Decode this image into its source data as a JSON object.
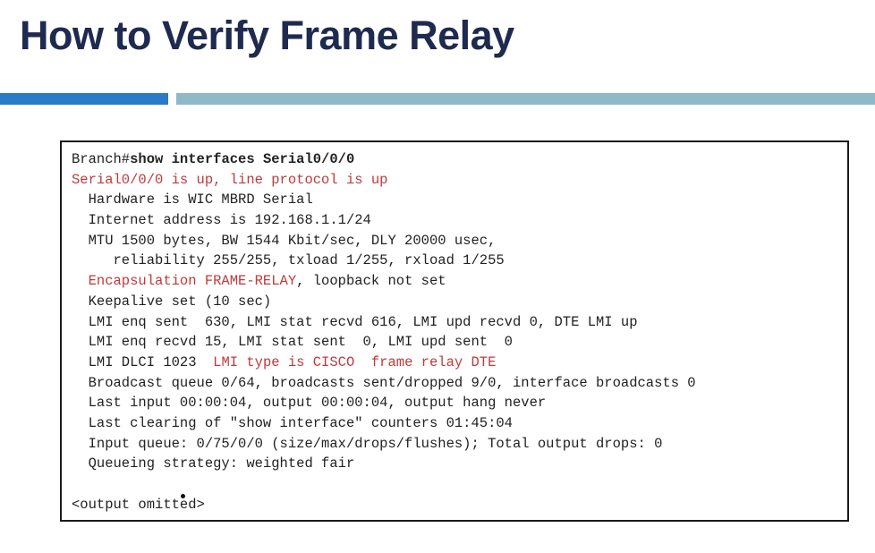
{
  "slide": {
    "title": "How to Verify Frame Relay"
  },
  "colors": {
    "title": "#1f2a4f",
    "bar_left": "#2a7ac9",
    "bar_right": "#8fb9c7",
    "highlight_red": "#c0393b"
  },
  "terminal": {
    "prompt": "Branch#",
    "command": "show interfaces Serial0/0/0",
    "status_line": "Serial0/0/0 is up, line protocol is up",
    "hardware": "  Hardware is WIC MBRD Serial",
    "internet_address": "  Internet address is 192.168.1.1/24",
    "mtu": "  MTU 1500 bytes, BW 1544 Kbit/sec, DLY 20000 usec,",
    "reliability": "     reliability 255/255, txload 1/255, rxload 1/255",
    "encapsulation": "  Encapsulation FRAME-RELAY",
    "encapsulation_rest": ", loopback not set",
    "keepalive": "  Keepalive set (10 sec)",
    "lmi_sent": "  LMI enq sent  630, LMI stat recvd 616, LMI upd recvd 0, DTE LMI up",
    "lmi_recvd": "  LMI enq recvd 15, LMI stat sent  0, LMI upd sent  0",
    "lmi_dlci": "  LMI DLCI 1023  ",
    "lmi_type": "LMI type is CISCO  frame relay DTE",
    "broadcast": "  Broadcast queue 0/64, broadcasts sent/dropped 9/0, interface broadcasts 0",
    "last_input": "  Last input 00:00:04, output 00:00:04, output hang never",
    "last_clearing": "  Last clearing of \"show interface\" counters 01:45:04",
    "input_queue": "  Input queue: 0/75/0/0 (size/max/drops/flushes); Total output drops: 0",
    "queueing": "  Queueing strategy: weighted fair",
    "omitted": "<output omitted>"
  }
}
